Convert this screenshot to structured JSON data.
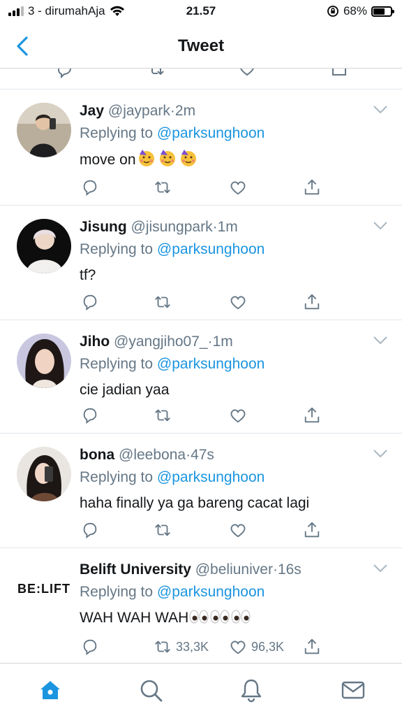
{
  "status_bar": {
    "carrier": "3 - dirumahAja",
    "time": "21.57",
    "battery": "68%",
    "battery_level": 0.68
  },
  "header": {
    "title": "Tweet",
    "back_icon": "chevron-left-icon"
  },
  "colors": {
    "accent": "#1b95e0",
    "muted": "#657786",
    "text": "#14171a",
    "divider": "#e1e8ed"
  },
  "replying_prefix": "Replying to",
  "tweets": [
    {
      "name": "Jay",
      "handle": "@jaypark",
      "sep": "·",
      "time": "2m",
      "mention": "@parksunghoon",
      "text": "move on",
      "emoji": "partying-face",
      "emoji_count": 3,
      "retweets": "",
      "likes": ""
    },
    {
      "name": "Jisung",
      "handle": "@jisungpark",
      "sep": "·",
      "time": "1m",
      "mention": "@parksunghoon",
      "text": "tf?",
      "retweets": "",
      "likes": ""
    },
    {
      "name": "Jiho",
      "handle": "@yangjiho07_",
      "sep": "·",
      "time": "1m",
      "mention": "@parksunghoon",
      "text": "cie jadian yaa",
      "retweets": "",
      "likes": ""
    },
    {
      "name": "bona",
      "handle": "@leebona",
      "sep": "·",
      "time": "47s",
      "mention": "@parksunghoon",
      "text": "haha finally ya ga bareng cacat lagi",
      "retweets": "",
      "likes": ""
    },
    {
      "name": "Belift University",
      "handle": "@beliuniver",
      "sep": "·",
      "time": "16s",
      "mention": "@parksunghoon",
      "text": "WAH WAH WAH",
      "emoji": "eyes",
      "emoji_count": 3,
      "avatar_logo": "BE:LIFT",
      "retweets": "33,3K",
      "likes": "96,3K"
    }
  ],
  "tab_bar": {
    "tabs": [
      "home-icon",
      "search-icon",
      "notifications-icon",
      "messages-icon"
    ]
  }
}
